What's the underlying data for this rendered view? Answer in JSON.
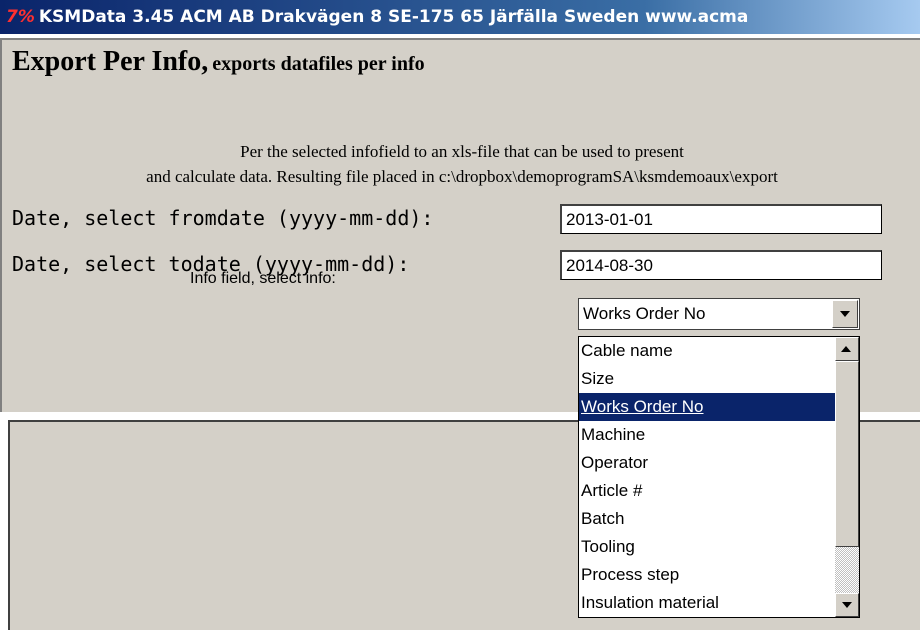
{
  "window": {
    "logo": "7%",
    "title": "KSMData 3.45  ACM AB  Drakvägen 8  SE-175 65 Järfälla  Sweden  www.acma"
  },
  "heading": {
    "main": "Export Per Info,",
    "sub": "exports datafiles per info"
  },
  "description": {
    "line1": "Per the selected infofield to an xls-file that can be used to present",
    "line2": "and calculate data. Resulting file placed in c:\\dropbox\\demoprogramSA\\ksmdemoaux\\export"
  },
  "form": {
    "from_label": "Date, select fromdate (yyyy-mm-dd):",
    "from_value": "2013-01-01",
    "to_label": "Date, select todate (yyyy-mm-dd):",
    "to_value": "2014-08-30",
    "info_label": "Info field, select info:",
    "info_selected": "Works Order No"
  },
  "dropdown": {
    "options": [
      "Cable name",
      "Size",
      "Works Order No",
      "Machine",
      "Operator",
      "Article #",
      "Batch",
      "Tooling",
      "Process step",
      "Insulation material"
    ],
    "selected_index": 2
  },
  "icons": {
    "select_button": "chevron-down-icon",
    "scroll_up": "scroll-up-arrow-icon",
    "scroll_down": "scroll-down-arrow-icon"
  },
  "colors": {
    "panel_bg": "#d4d0c8",
    "selection_bg": "#0a246a",
    "title_gradient_start": "#0a246a"
  }
}
